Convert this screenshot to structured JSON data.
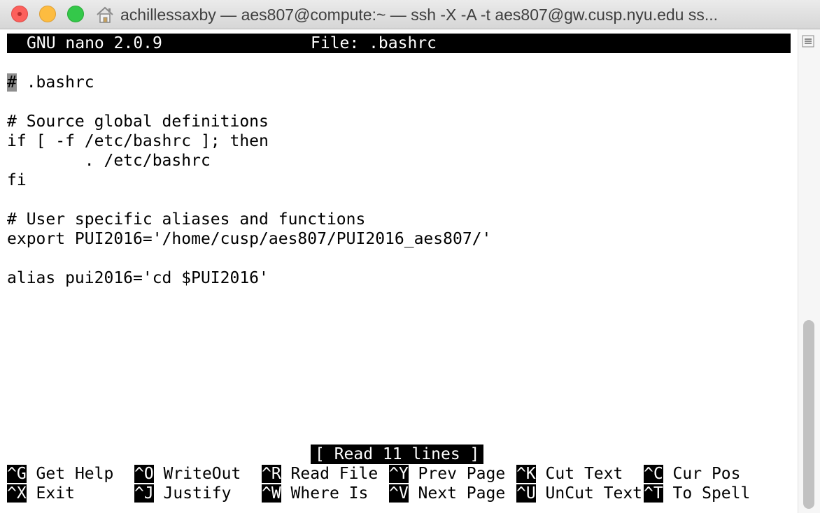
{
  "window": {
    "title": "achillessaxby — aes807@compute:~ — ssh -X -A -t aes807@gw.cusp.nyu.edu ss..."
  },
  "icons": {
    "title_icon": "home-icon",
    "scroll_menu": "hamburger-lines-icon"
  },
  "nano": {
    "version_label": "GNU nano 2.0.9",
    "file_label": "File: .bashrc",
    "status_message": "[ Read 11 lines ]",
    "cursor_char": "#",
    "lines": [
      " .bashrc",
      "",
      "# Source global definitions",
      "if [ -f /etc/bashrc ]; then",
      "        . /etc/bashrc",
      "fi",
      "",
      "# User specific aliases and functions",
      "export PUI2016='/home/cusp/aes807/PUI2016_aes807/'",
      "",
      "alias pui2016='cd $PUI2016'"
    ],
    "shortcuts": [
      {
        "key": "^G",
        "label": " Get Help"
      },
      {
        "key": "^X",
        "label": " Exit"
      },
      {
        "key": "^O",
        "label": " WriteOut"
      },
      {
        "key": "^J",
        "label": " Justify"
      },
      {
        "key": "^R",
        "label": " Read File"
      },
      {
        "key": "^W",
        "label": " Where Is"
      },
      {
        "key": "^Y",
        "label": " Prev Page"
      },
      {
        "key": "^V",
        "label": " Next Page"
      },
      {
        "key": "^K",
        "label": " Cut Text"
      },
      {
        "key": "^U",
        "label": " UnCut Text"
      },
      {
        "key": "^C",
        "label": " Cur Pos"
      },
      {
        "key": "^T",
        "label": " To Spell"
      }
    ]
  },
  "colors": {
    "close": "#fc605c",
    "minimize": "#fdbc40",
    "maximize": "#34c84a",
    "inverse_bg": "#000000",
    "inverse_fg": "#ffffff",
    "cursor": "#8e8e8e"
  }
}
